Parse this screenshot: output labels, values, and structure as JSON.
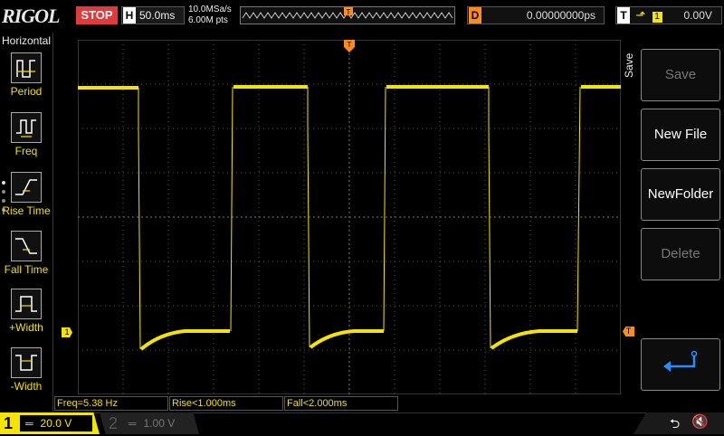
{
  "header": {
    "brand": "RIGOL",
    "run_state": "STOP",
    "timebase_letter": "H",
    "timebase": "50.0ms",
    "sample_rate": "10.0MSa/s",
    "memory_depth": "6.00M pts",
    "trig_pos_marker": "T",
    "delay_letter": "D",
    "delay": "0.00000000ps",
    "trig_letter": "T",
    "trig_source": "1",
    "trig_level": "0.00V"
  },
  "left_menu": {
    "title": "Horizontal",
    "items": [
      {
        "label": "Period",
        "icon": "period-icon"
      },
      {
        "label": "Freq",
        "icon": "freq-icon"
      },
      {
        "label": "Rise Time",
        "icon": "rise-time-icon"
      },
      {
        "label": "Fall Time",
        "icon": "fall-time-icon"
      },
      {
        "label": "+Width",
        "icon": "pos-width-icon"
      },
      {
        "label": "-Width",
        "icon": "neg-width-icon"
      }
    ]
  },
  "right_menu": {
    "title": "Save",
    "buttons": [
      {
        "label": "Save",
        "enabled": false
      },
      {
        "label": "New File",
        "enabled": true
      },
      {
        "label": "NewFolder",
        "enabled": true
      },
      {
        "label": "Delete",
        "enabled": false
      }
    ],
    "return_icon": "return-arrow-icon"
  },
  "screen": {
    "ch1_marker": "1",
    "trig_level_marker": "T",
    "trig_top_marker": "T"
  },
  "measurements": [
    {
      "text": "Freq=5.38 Hz"
    },
    {
      "text": "Rise<1.000ms"
    },
    {
      "text": "Fall<2.000ms"
    }
  ],
  "channels": [
    {
      "num": "1",
      "scale": "20.0 V",
      "active": true
    },
    {
      "num": "2",
      "scale": "1.00 V",
      "active": false
    }
  ],
  "status_icons": [
    "usb-icon",
    "speaker-muted-icon"
  ],
  "colors": {
    "ch1": "#f5e400",
    "trigger": "#ff8c1a",
    "stop": "#e23a3a"
  }
}
